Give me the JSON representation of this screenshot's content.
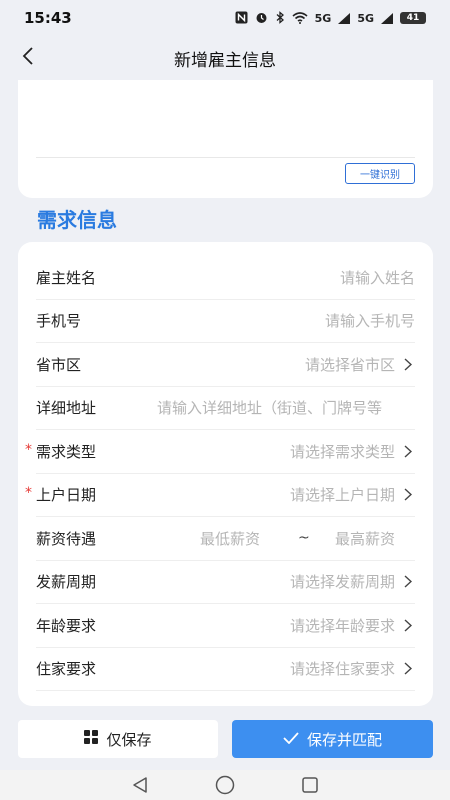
{
  "status_bar": {
    "time": "15:43",
    "icons": [
      "nfc-icon",
      "alarm-icon",
      "bluetooth-icon",
      "wifi-icon",
      "signal-5g-icon",
      "signal-5g-icon",
      "battery-icon"
    ],
    "signal1": "5G",
    "signal2": "5G",
    "battery": "41"
  },
  "nav": {
    "title": "新增雇主信息",
    "back_icon": "chevron-left-icon"
  },
  "top_card": {
    "recognize_label": "一键识别"
  },
  "section": {
    "title": "需求信息"
  },
  "form": {
    "rows": [
      {
        "label": "雇主姓名",
        "placeholder": "请输入姓名",
        "required": false,
        "chevron": false
      },
      {
        "label": "手机号",
        "placeholder": "请输入手机号",
        "required": false,
        "chevron": false
      },
      {
        "label": "省市区",
        "placeholder": "请选择省市区",
        "required": false,
        "chevron": true
      },
      {
        "label": "详细地址",
        "placeholder": "请输入详细地址（街道、门牌号等",
        "required": false,
        "chevron": false
      },
      {
        "label": "需求类型",
        "placeholder": "请选择需求类型",
        "required": true,
        "chevron": true
      },
      {
        "label": "上户日期",
        "placeholder": "请选择上户日期",
        "required": true,
        "chevron": true
      },
      {
        "label": "薪资待遇",
        "min_placeholder": "最低薪资",
        "separator": "~",
        "max_placeholder": "最高薪资",
        "required": false
      },
      {
        "label": "发薪周期",
        "placeholder": "请选择发薪周期",
        "required": false,
        "chevron": true
      },
      {
        "label": "年龄要求",
        "placeholder": "请选择年龄要求",
        "required": false,
        "chevron": true
      },
      {
        "label": "住家要求",
        "placeholder": "请选择住家要求",
        "required": false,
        "chevron": true
      }
    ],
    "required_mark": "*"
  },
  "actions": {
    "save_label": "仅保存",
    "save_icon": "grid-icon",
    "save_match_label": "保存并匹配",
    "save_match_icon": "check-icon"
  },
  "colors": {
    "accent": "#3d8ff0",
    "section_title": "#2a7be0",
    "required": "#e53935",
    "placeholder": "#b5b5b5",
    "background": "#eef0f5"
  }
}
